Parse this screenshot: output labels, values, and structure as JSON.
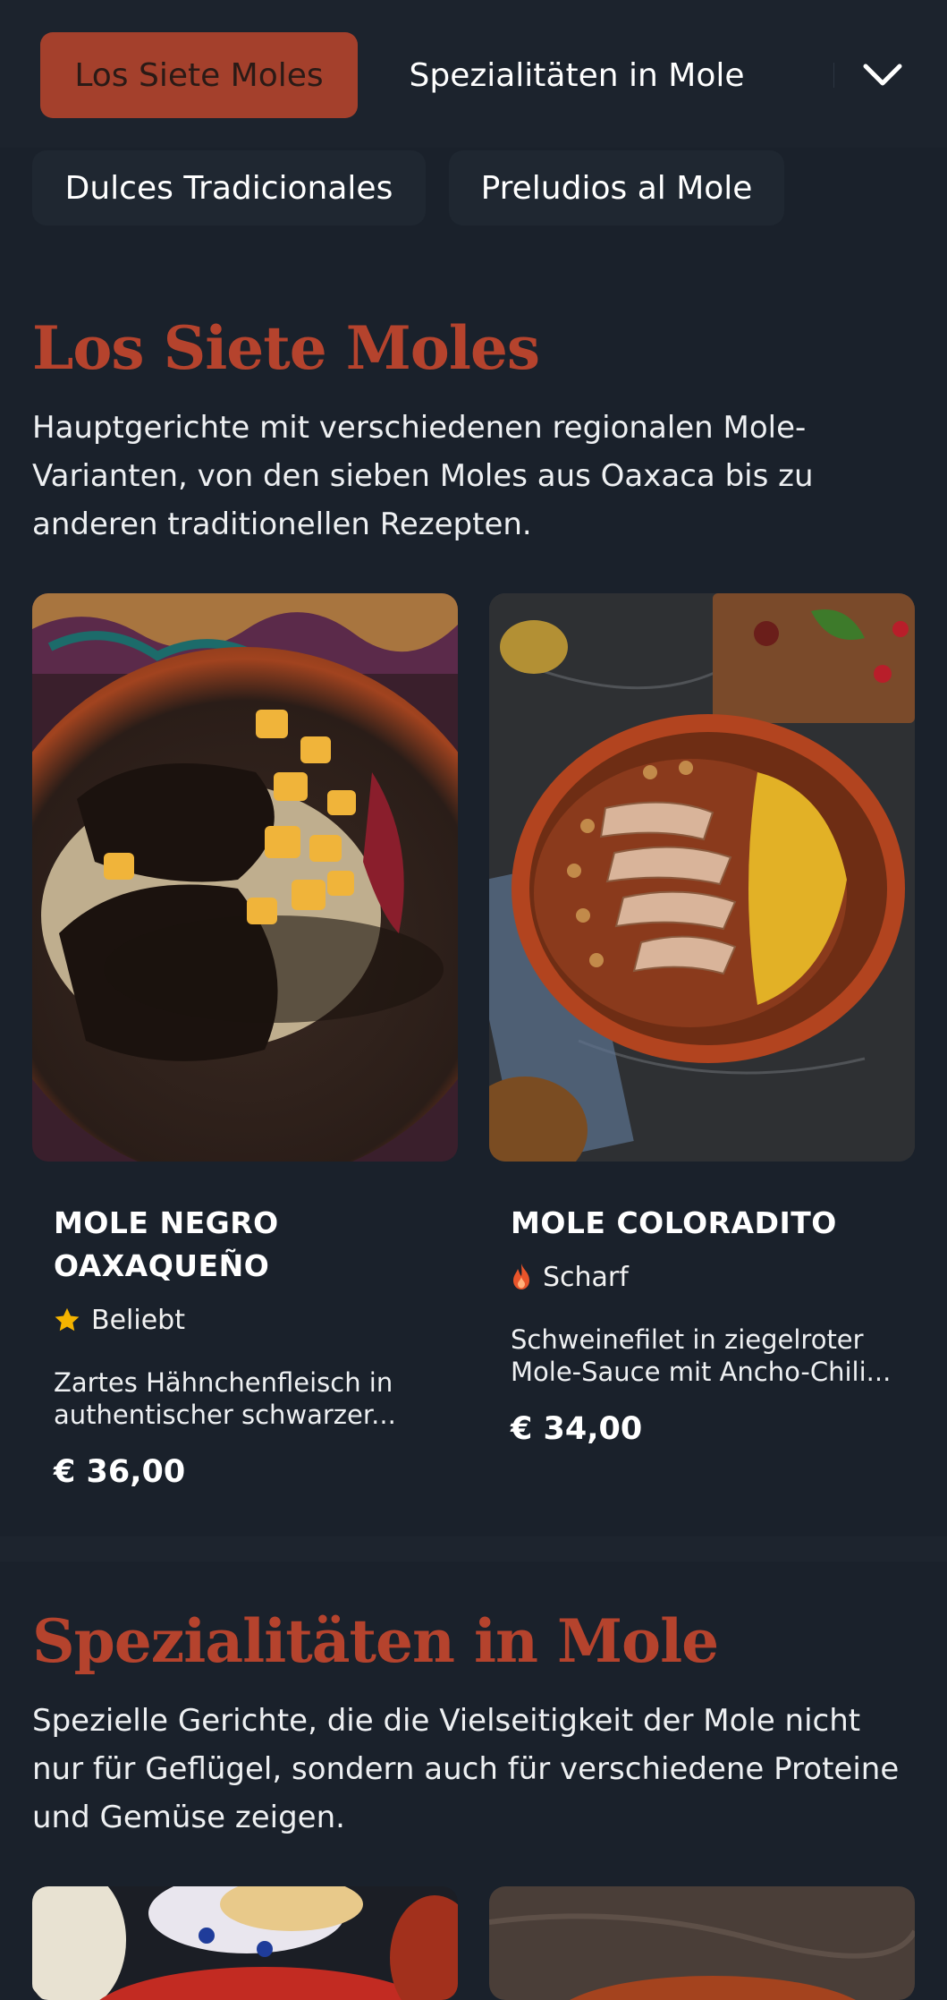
{
  "nav": {
    "tabs": [
      {
        "label": "Los Siete Moles",
        "active": true
      },
      {
        "label": "Spezialitäten in Mole",
        "active": false
      },
      {
        "label": "Dulces Tradicionales",
        "active": false
      },
      {
        "label": "Preludios al Mole",
        "active": false
      }
    ],
    "expand_icon": "chevron-down-icon"
  },
  "colors": {
    "background": "#1a212b",
    "accent": "#a4402c",
    "title": "#b5432d",
    "star": "#f5b400",
    "flame": "#e8542a"
  },
  "sections": [
    {
      "title": "Los Siete Moles",
      "description": "Hauptgerichte mit verschiedenen regionalen Mole-Varianten, von den sieben Moles aus Oaxaca bis zu anderen traditionellen Rezepten.",
      "items": [
        {
          "name": "MOLE NEGRO OAXAQUEÑO",
          "tag": "Beliebt",
          "tag_icon": "star-icon",
          "description": "Zartes Hähnchenfleisch in authentischer schwarzer...",
          "price": "€ 36,00"
        },
        {
          "name": "MOLE COLORADITO",
          "tag": "Scharf",
          "tag_icon": "flame-icon",
          "description": "Schweinefilet in ziegelroter Mole-Sauce mit Ancho-Chili...",
          "price": "€ 34,00"
        }
      ]
    },
    {
      "title": "Spezialitäten in Mole",
      "description": "Spezielle Gerichte, die die Vielseitigkeit der Mole nicht nur für Geflügel, sondern auch für verschiedene Proteine und Gemüse zeigen."
    }
  ]
}
